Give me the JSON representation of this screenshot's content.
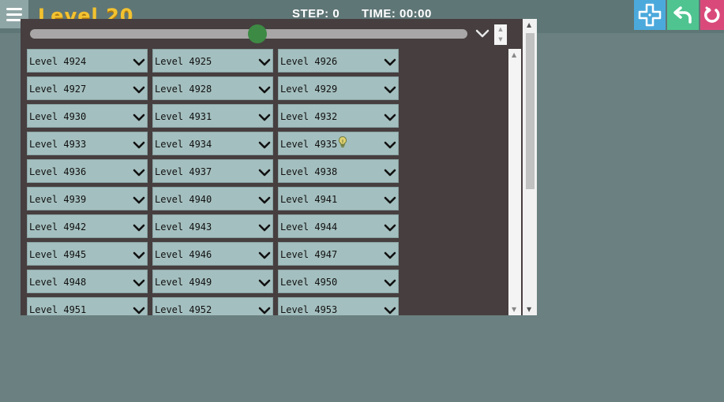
{
  "header": {
    "level_title": "Level 20",
    "step": "STEP: 0",
    "time": "TIME: 00:00",
    "accent_title": "#f2c230",
    "buttons": {
      "move": {
        "icon": "move-icon",
        "color": "#4ba9dc"
      },
      "undo": {
        "icon": "undo-icon",
        "color": "#4fc490"
      },
      "restart": {
        "icon": "restart-icon",
        "color": "#d94a7a"
      }
    }
  },
  "selector": {
    "slider_value": 0.52,
    "slider_color": "#3d8a44",
    "rows": [
      [
        "Level 4924",
        "Level 4925",
        "Level 4926"
      ],
      [
        "Level 4927",
        "Level 4928",
        "Level 4929"
      ],
      [
        "Level 4930",
        "Level 4931",
        "Level 4932"
      ],
      [
        "Level 4933",
        "Level 4934",
        "Level 4935"
      ],
      [
        "Level 4936",
        "Level 4937",
        "Level 4938"
      ],
      [
        "Level 4939",
        "Level 4940",
        "Level 4941"
      ],
      [
        "Level 4942",
        "Level 4943",
        "Level 4944"
      ],
      [
        "Level 4945",
        "Level 4946",
        "Level 4947"
      ],
      [
        "Level 4948",
        "Level 4949",
        "Level 4950"
      ],
      [
        "Level 4951",
        "Level 4952",
        "Level 4953"
      ]
    ],
    "hint_on": "Level 4935"
  }
}
